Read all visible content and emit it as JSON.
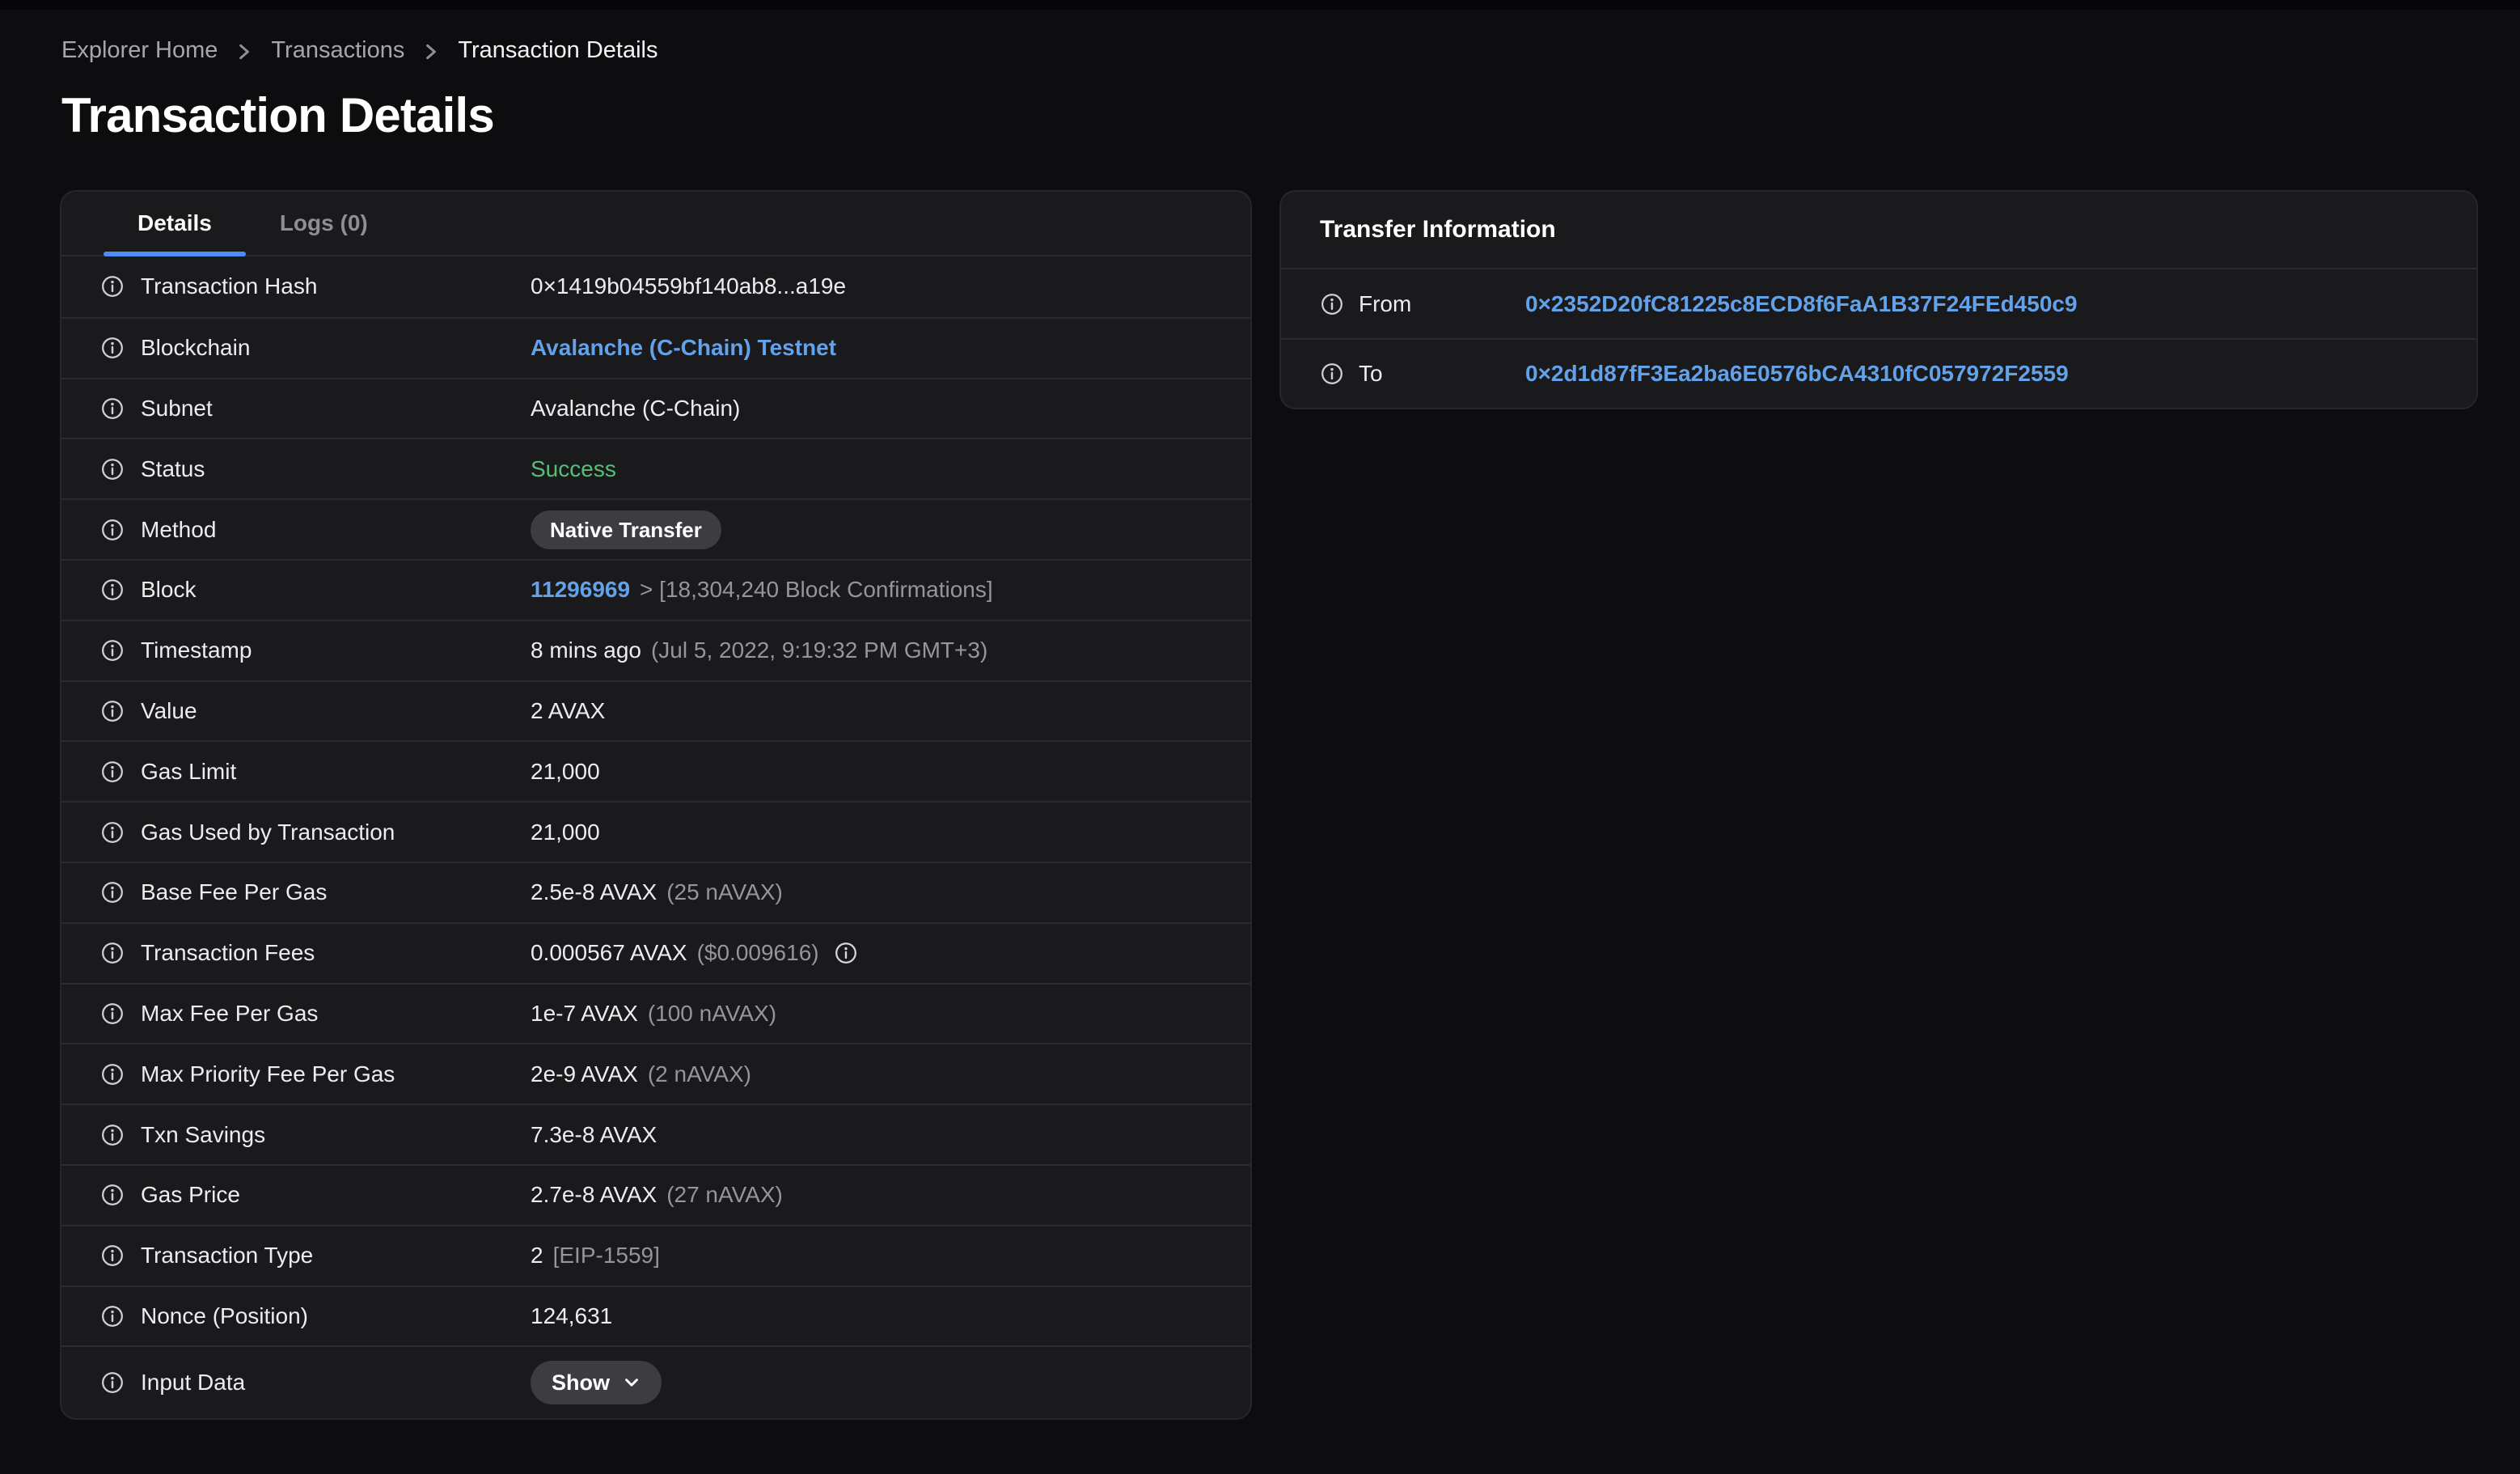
{
  "breadcrumb": {
    "items": [
      "Explorer Home",
      "Transactions",
      "Transaction Details"
    ]
  },
  "page": {
    "title": "Transaction Details"
  },
  "details_card": {
    "tabs": [
      {
        "label": "Details",
        "active": true
      },
      {
        "label": "Logs (0)",
        "active": false
      }
    ],
    "rows": [
      {
        "label": "Transaction Hash",
        "value": "0×1419b04559bf140ab8...a19e",
        "value_type": "text"
      },
      {
        "label": "Blockchain",
        "value": "Avalanche (C-Chain) Testnet",
        "value_type": "link"
      },
      {
        "label": "Subnet",
        "value": "Avalanche (C-Chain)",
        "value_type": "text"
      },
      {
        "label": "Status",
        "value": "Success",
        "value_type": "success"
      },
      {
        "label": "Method",
        "value": "Native Transfer",
        "value_type": "badge"
      },
      {
        "label": "Block",
        "value": "11296969",
        "value_type": "link",
        "suffix": "> [18,304,240 Block Confirmations]"
      },
      {
        "label": "Timestamp",
        "value": "8 mins ago",
        "value_type": "text",
        "suffix": "(Jul 5, 2022, 9:19:32 PM GMT+3)"
      },
      {
        "label": "Value",
        "value": "2 AVAX",
        "value_type": "text"
      },
      {
        "label": "Gas Limit",
        "value": "21,000",
        "value_type": "text"
      },
      {
        "label": "Gas Used by Transaction",
        "value": "21,000",
        "value_type": "text"
      },
      {
        "label": "Base Fee Per Gas",
        "value": "2.5e-8 AVAX",
        "value_type": "text",
        "suffix": "(25 nAVAX)"
      },
      {
        "label": "Transaction Fees",
        "value": "0.000567 AVAX",
        "value_type": "text",
        "suffix": "($0.009616)",
        "info_after": true
      },
      {
        "label": "Max Fee Per Gas",
        "value": "1e-7 AVAX",
        "value_type": "text",
        "suffix": "(100 nAVAX)"
      },
      {
        "label": "Max Priority Fee Per Gas",
        "value": "2e-9 AVAX",
        "value_type": "text",
        "suffix": "(2 nAVAX)"
      },
      {
        "label": "Txn Savings",
        "value": "7.3e-8 AVAX",
        "value_type": "text"
      },
      {
        "label": "Gas Price",
        "value": "2.7e-8 AVAX",
        "value_type": "text",
        "suffix": "(27 nAVAX)"
      },
      {
        "label": "Transaction Type",
        "value": "2",
        "value_type": "text",
        "suffix": "[EIP-1559]"
      },
      {
        "label": "Nonce (Position)",
        "value": "124,631",
        "value_type": "text"
      },
      {
        "label": "Input Data",
        "value": "Show",
        "value_type": "button"
      }
    ]
  },
  "transfer_card": {
    "title": "Transfer Information",
    "rows": [
      {
        "label": "From",
        "value": "0×2352D20fC81225c8ECD8f6FaA1B37F24FEd450c9"
      },
      {
        "label": "To",
        "value": "0×2d1d87fF3Ea2ba6E0576bCA4310fC057972F2559"
      }
    ]
  },
  "colors": {
    "page_bg": "#0d0d0f",
    "card_bg": "#1a1a1c",
    "accent_blue": "#4c8df6",
    "link_blue": "#63a1e8",
    "success_green": "#57be74",
    "badge_bg": "#3d3d41",
    "text_primary": "#ededf0",
    "text_secondary": "#95959a"
  }
}
